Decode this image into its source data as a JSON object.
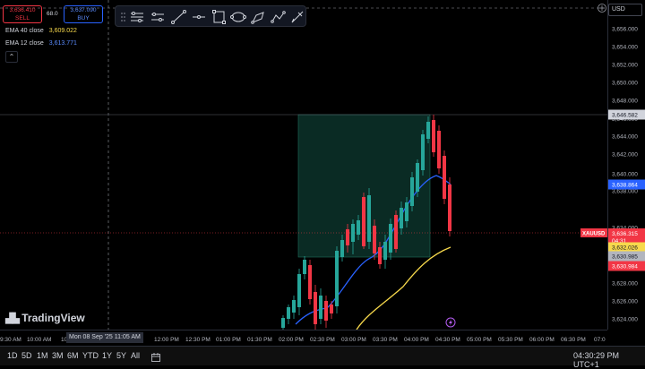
{
  "trade": {
    "sell_price": "3,636.410",
    "sell_label": "SELL",
    "spread": "68.0",
    "buy_price": "3,637.090",
    "buy_label": "BUY"
  },
  "indicators": [
    {
      "label": "EMA 40 close",
      "value": "3,609.022",
      "color": "#f7d94c"
    },
    {
      "label": "EMA 12 close",
      "value": "3,613.771",
      "color": "#2962ff"
    }
  ],
  "currency": "USD",
  "logo_text": "TradingView",
  "price_axis": {
    "ticks": [
      "3,656.000",
      "3,654.000",
      "3,652.000",
      "3,650.000",
      "3,648.000",
      "3,644.000",
      "3,642.000",
      "3,640.000",
      "3,638.000",
      "3,634.000",
      "3,628.000",
      "3,626.000",
      "3,624.000"
    ],
    "partial_top_tick": "3,646.000"
  },
  "price_labels": {
    "high_line": "3,646.582",
    "ema12": "3,638.864",
    "symbol": "XAUUSD",
    "current": "3,636.315",
    "countdown": "04:31",
    "ema40": "3,632.026",
    "gray_level": "3,630.985",
    "red_level": "3,630.984"
  },
  "time_axis": {
    "ticks": [
      "9:30 AM",
      "10:00 AM",
      "10",
      "12:00 PM",
      "12:30 PM",
      "01:00 PM",
      "01:30 PM",
      "02:00 PM",
      "02:30 PM",
      "03:00 PM",
      "03:30 PM",
      "04:00 PM",
      "04:30 PM",
      "05:00 PM",
      "05:30 PM",
      "06:00 PM",
      "06:30 PM",
      "07:0"
    ],
    "crosshair_tooltip": "Mon 08 Sep '25   11:05 AM"
  },
  "bottom_bar": {
    "timeframes": [
      "1D",
      "5D",
      "1M",
      "3M",
      "6M",
      "YTD",
      "1Y",
      "5Y",
      "All"
    ],
    "clock": "04:30:29 PM UTC+1"
  },
  "colors": {
    "up": "#26a69a",
    "down": "#f23645",
    "box_fill": "#0e3a30",
    "ema12": "#2962ff",
    "ema40": "#f7d94c"
  },
  "tools": [
    "horizontal-lines-icon",
    "parallel-lines-icon",
    "trend-line-icon",
    "horizontal-ray-icon",
    "rectangle-icon",
    "ellipse-icon",
    "brush-icon",
    "path-icon",
    "pen-icon"
  ]
}
